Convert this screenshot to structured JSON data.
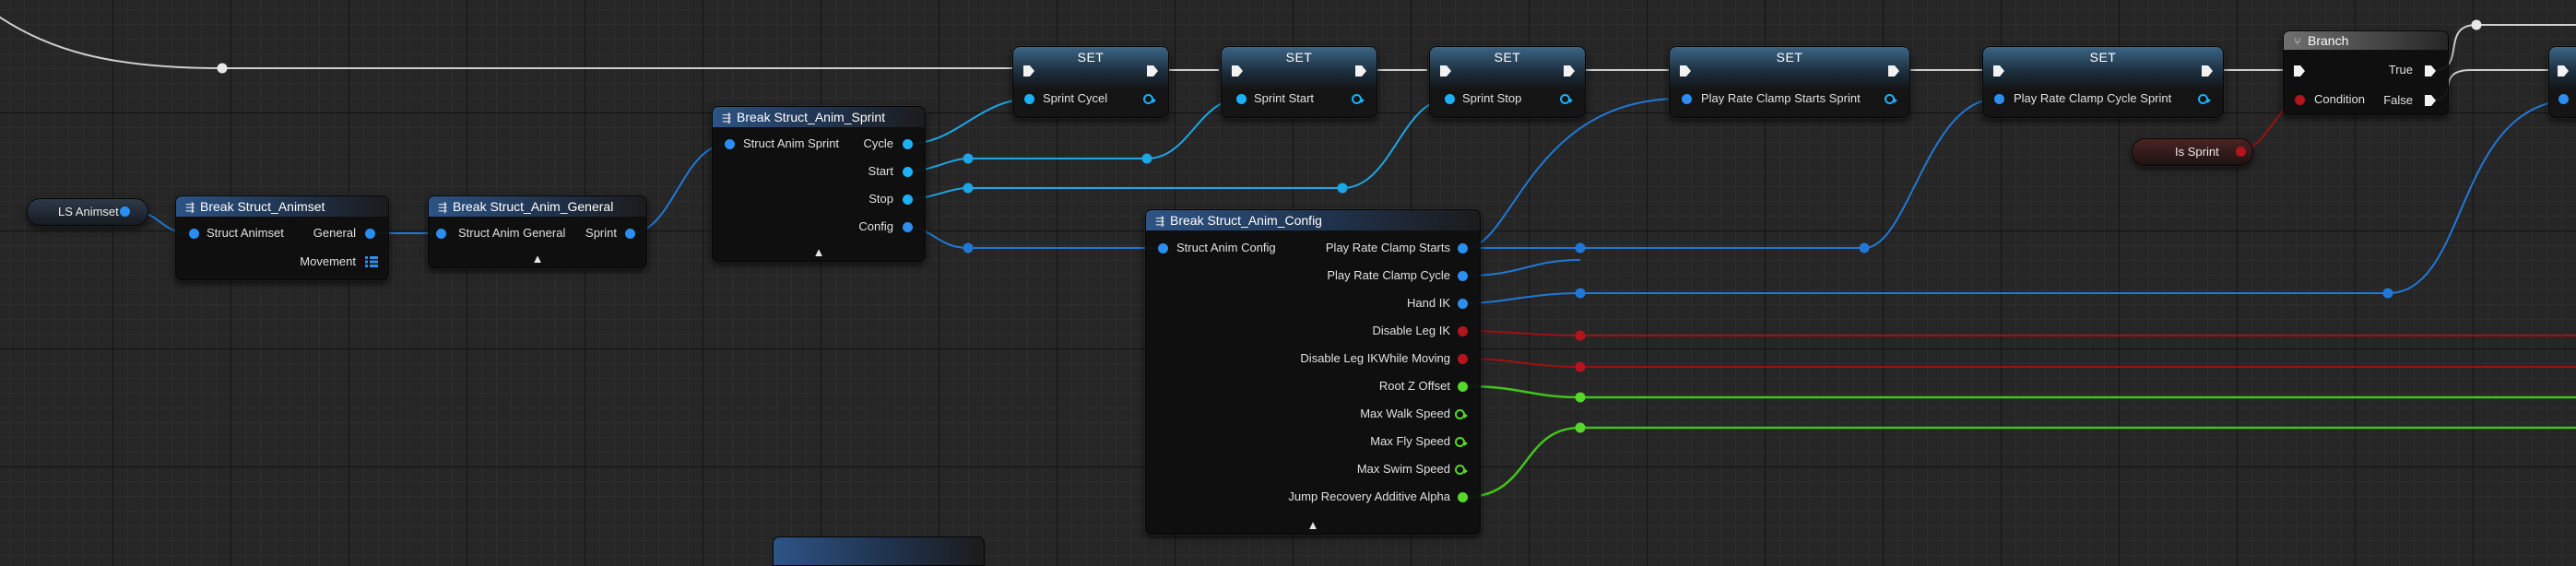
{
  "nodes": {
    "ls_animset": {
      "label": "LS Animset"
    },
    "is_sprint": {
      "label": "Is Sprint"
    },
    "break_animset": {
      "title": "Break Struct_Animset",
      "input": "Struct Animset",
      "outputs": [
        "General",
        "Movement"
      ]
    },
    "break_general": {
      "title": "Break Struct_Anim_General",
      "input": "Struct Anim General",
      "outputs": [
        "Sprint"
      ]
    },
    "break_sprint": {
      "title": "Break Struct_Anim_Sprint",
      "input": "Struct Anim Sprint",
      "outputs": [
        "Cycle",
        "Start",
        "Stop",
        "Config"
      ]
    },
    "break_config": {
      "title": "Break Struct_Anim_Config",
      "input": "Struct Anim Config",
      "outputs": [
        "Play Rate Clamp Starts",
        "Play Rate Clamp Cycle",
        "Hand IK",
        "Disable Leg IK",
        "Disable Leg IKWhile Moving",
        "Root Z Offset",
        "Max Walk Speed",
        "Max Fly Speed",
        "Max Swim Speed",
        "Jump Recovery Additive Alpha"
      ]
    },
    "set_nodes": [
      {
        "title": "SET",
        "var": "Sprint Cycel"
      },
      {
        "title": "SET",
        "var": "Sprint Start"
      },
      {
        "title": "SET",
        "var": "Sprint Stop"
      },
      {
        "title": "SET",
        "var": "Play Rate Clamp Starts Sprint"
      },
      {
        "title": "SET",
        "var": "Play Rate Clamp Cycle Sprint"
      }
    ],
    "branch": {
      "title": "Branch",
      "input": "Condition",
      "outputs": [
        "True",
        "False"
      ]
    }
  },
  "icons": {
    "break": "break-struct-icon",
    "branch": "branch-icon",
    "collapse": "chevron-up-icon"
  },
  "colors": {
    "exec": "#cfcfcf",
    "struct_blue": "#1f78d6",
    "object_cyan": "#1ca6e6",
    "bool_red": "#9c1111",
    "float_green": "#43c21d",
    "header_blue": "#2d5486"
  }
}
